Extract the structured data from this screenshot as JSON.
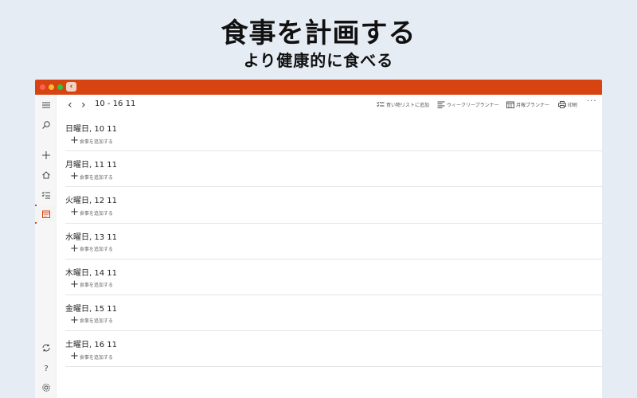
{
  "header": {
    "title": "食事を計画する",
    "subtitle": "より健康的に食べる"
  },
  "window": {
    "accent_color": "#d74411"
  },
  "toolbar": {
    "prev_icon": "chevron-left-icon",
    "next_icon": "chevron-right-icon",
    "date_range": "10 - 16 11",
    "shopping_list": "買い物リストに追加",
    "weekly_planner": "ウィークリープランナー",
    "monthly_planner": "月報プランナー",
    "print": "印刷",
    "more": "···"
  },
  "sidebar": {
    "items": [
      {
        "icon": "menu-icon"
      },
      {
        "icon": "search-icon"
      },
      {
        "icon": "plus-icon"
      },
      {
        "icon": "home-icon"
      },
      {
        "icon": "checklist-icon"
      },
      {
        "icon": "calendar-icon",
        "active": true
      },
      {
        "icon": "sync-icon"
      },
      {
        "icon": "help-icon"
      },
      {
        "icon": "settings-icon"
      }
    ]
  },
  "days": [
    {
      "label": "日曜日, 10 11",
      "add_label": "食事を追加する"
    },
    {
      "label": "月曜日, 11 11",
      "add_label": "食事を追加する"
    },
    {
      "label": "火曜日, 12 11",
      "add_label": "食事を追加する"
    },
    {
      "label": "水曜日, 13 11",
      "add_label": "食事を追加する"
    },
    {
      "label": "木曜日, 14 11",
      "add_label": "食事を追加する"
    },
    {
      "label": "金曜日, 15 11",
      "add_label": "食事を追加する"
    },
    {
      "label": "土曜日, 16 11",
      "add_label": "食事を追加する"
    }
  ]
}
